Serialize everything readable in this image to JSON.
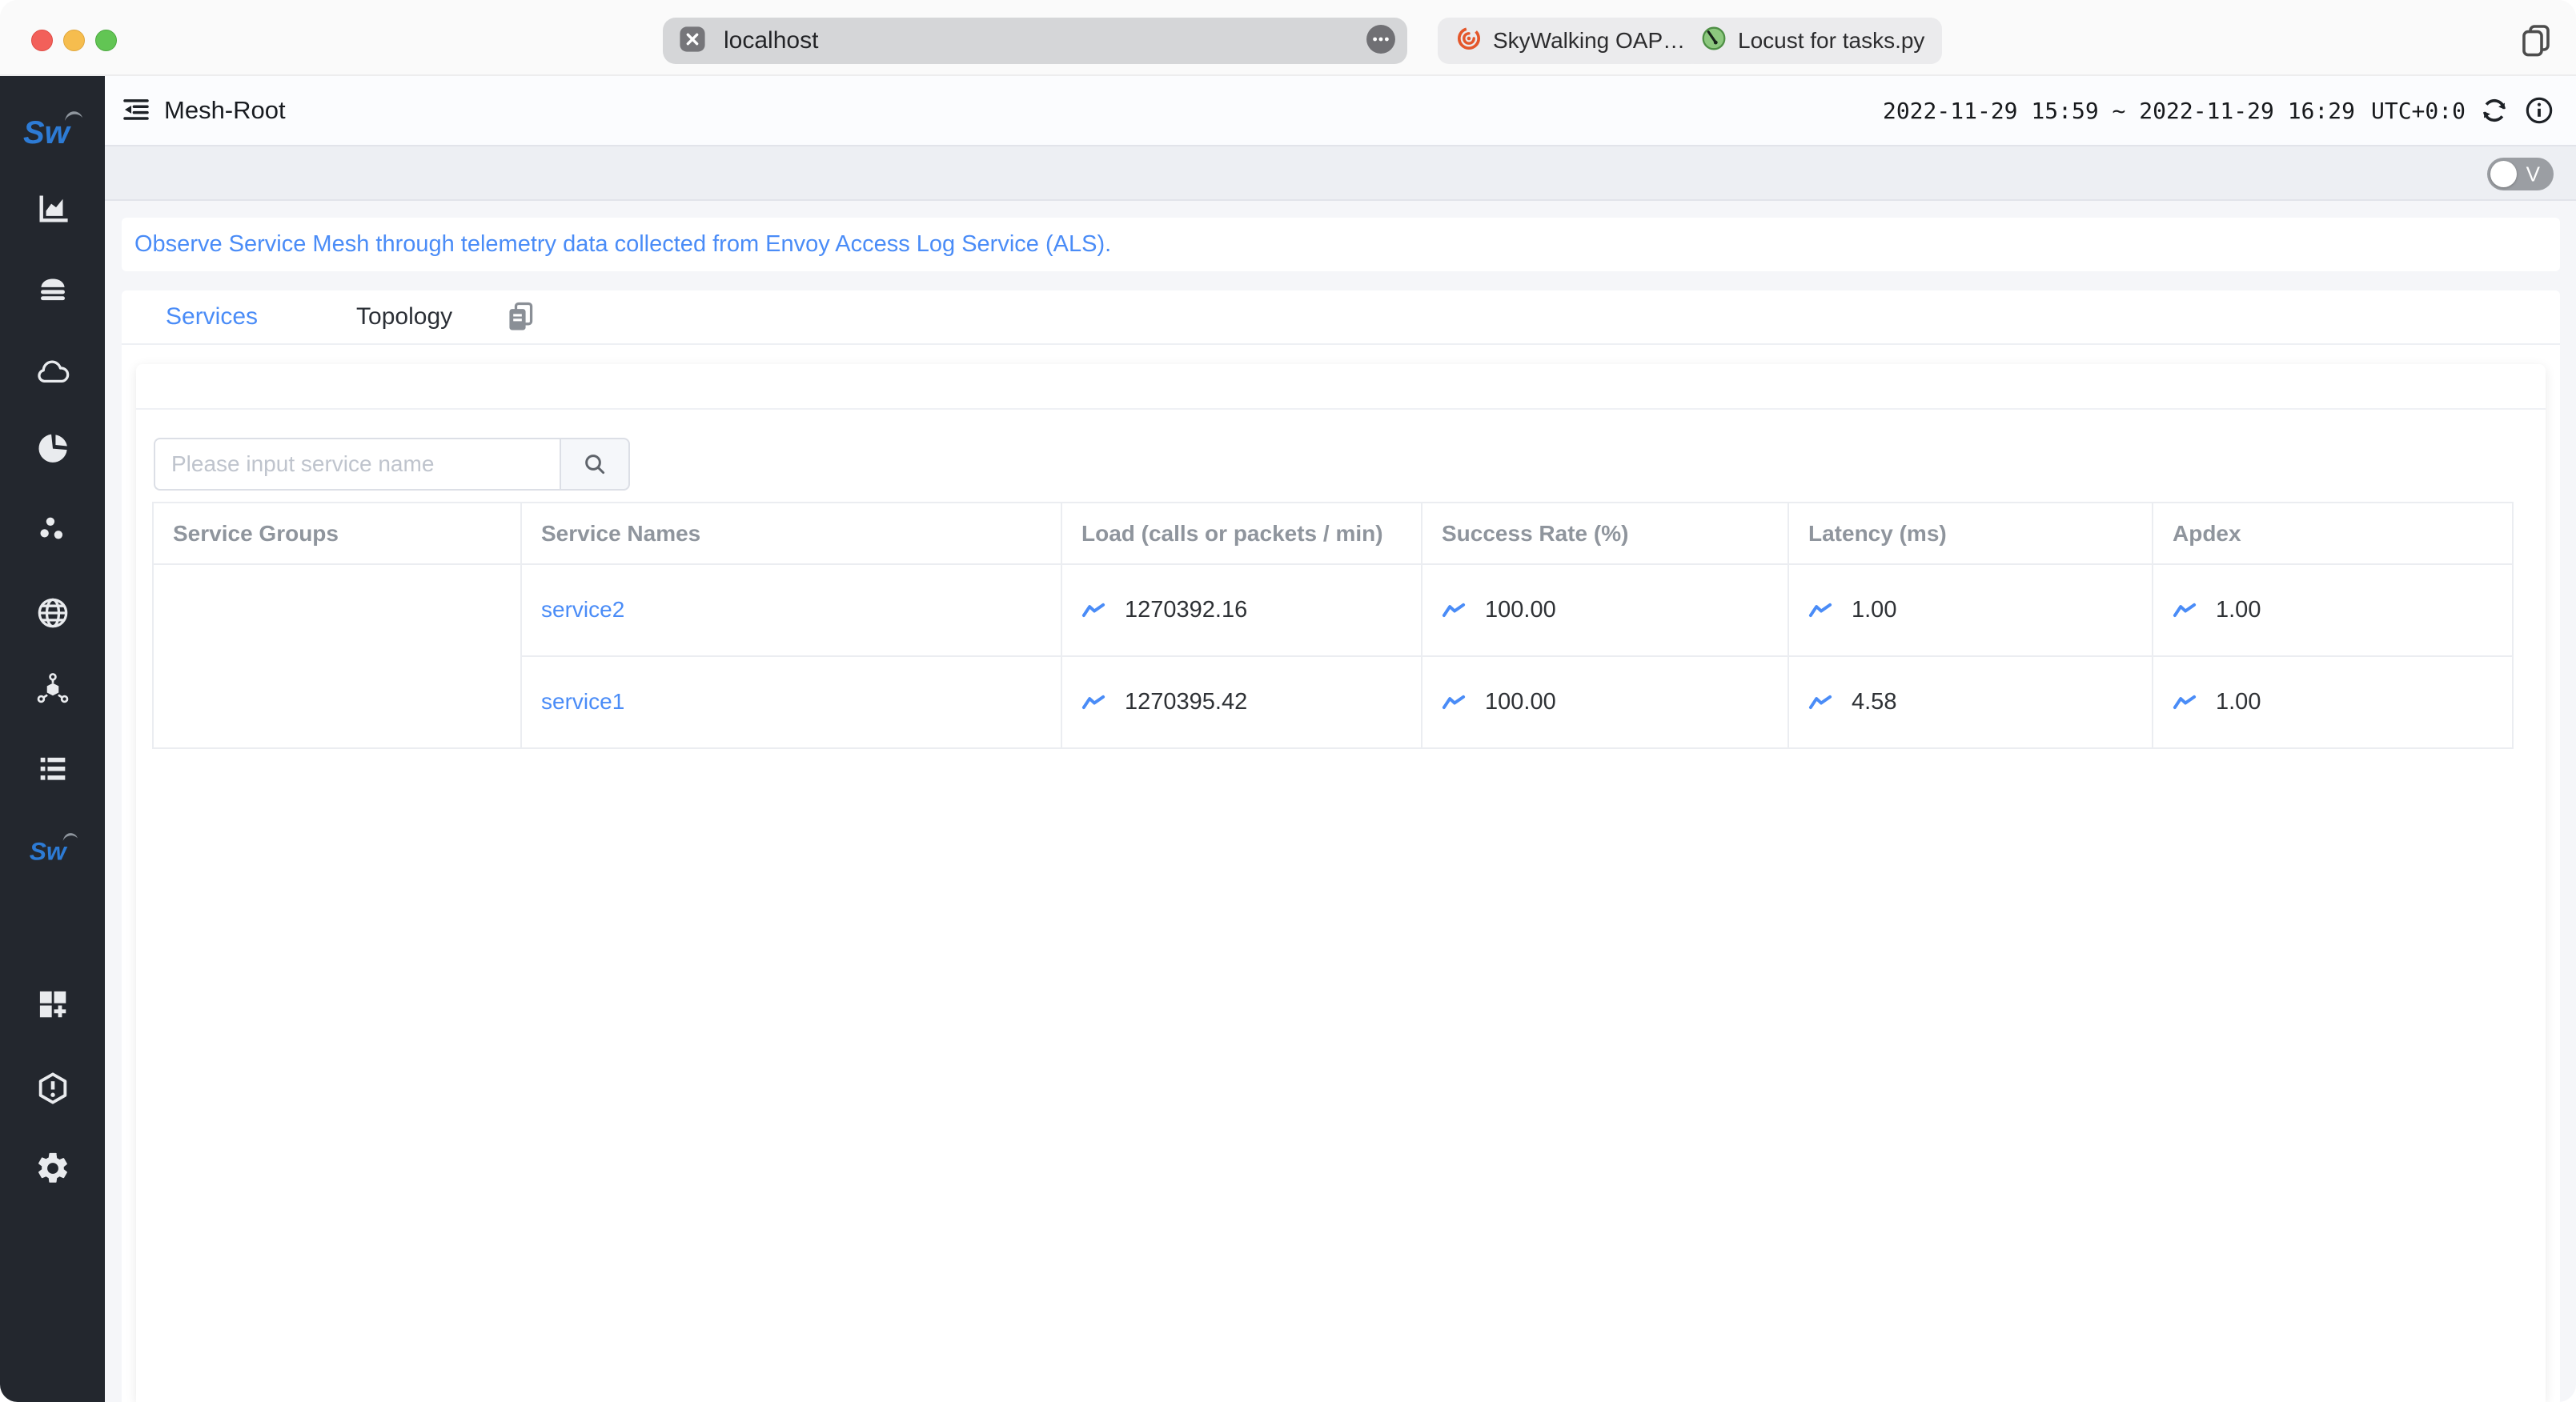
{
  "browser_chrome": {
    "address_bar": {
      "value": "localhost"
    },
    "tabs": [
      {
        "label": "SkyWalking OAP…",
        "icon": "skywalking-oap-favicon"
      },
      {
        "label": "Locust for tasks.py",
        "icon": "locust-favicon"
      }
    ]
  },
  "app_header": {
    "title": "Mesh-Root",
    "time_range": "2022-11-29 15:59 ~ 2022-11-29 16:29",
    "timezone": "UTC+0:0"
  },
  "toolbar": {
    "version_toggle_label": "V"
  },
  "banner": {
    "text": "Observe Service Mesh through telemetry data collected from Envoy Access Log Service (ALS)."
  },
  "content_tabs": {
    "services": "Services",
    "topology": "Topology"
  },
  "search": {
    "placeholder": "Please input service name"
  },
  "services_table": {
    "columns": [
      "Service Groups",
      "Service Names",
      "Load (calls or packets / min)",
      "Success Rate (%)",
      "Latency (ms)",
      "Apdex"
    ],
    "rows": [
      {
        "group": "",
        "name": "service2",
        "load": "1270392.16",
        "success_rate": "100.00",
        "latency": "1.00",
        "apdex": "1.00"
      },
      {
        "group": "",
        "name": "service1",
        "load": "1270395.42",
        "success_rate": "100.00",
        "latency": "4.58",
        "apdex": "1.00"
      }
    ]
  },
  "sidebar": {
    "logo": "Sw",
    "items": [
      {
        "icon": "skywalking-logo"
      },
      {
        "icon": "bar-chart"
      },
      {
        "icon": "server-layers"
      },
      {
        "icon": "cloud"
      },
      {
        "icon": "pie-segments"
      },
      {
        "icon": "scatter-dots"
      },
      {
        "icon": "globe"
      },
      {
        "icon": "topology-cube"
      },
      {
        "icon": "list"
      },
      {
        "icon": "skywalking-mesh-active"
      },
      {
        "icon": "dashboard-add"
      },
      {
        "icon": "alert-hexagon"
      },
      {
        "icon": "settings-gear"
      }
    ]
  },
  "colors": {
    "accent_blue": "#4a8cf7",
    "sidebar_bg": "#23272e",
    "toolbar_bg": "#edeff3",
    "link": "#4a8cf7"
  }
}
